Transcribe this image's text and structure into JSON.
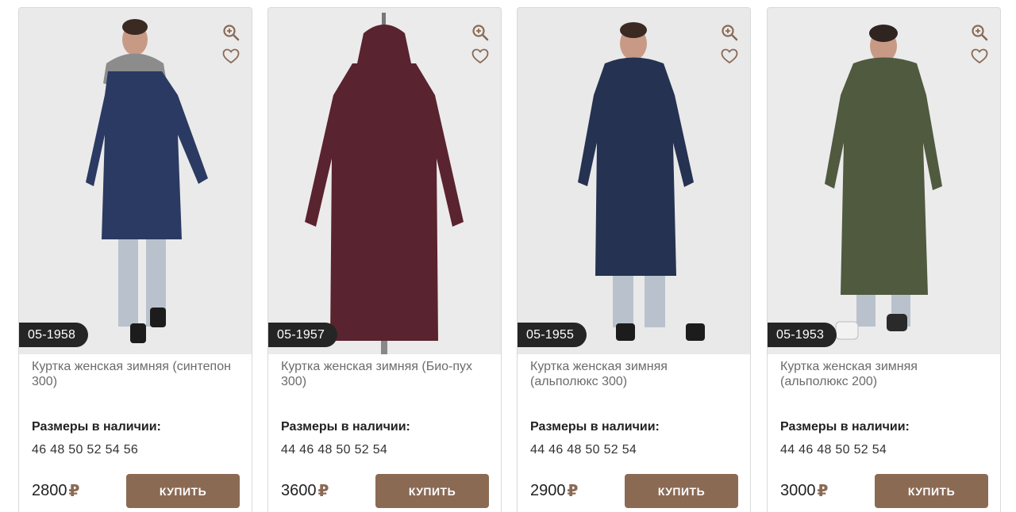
{
  "colors": {
    "accent": "#8b6a54",
    "badge": "#252525",
    "currency": "#8a6a55"
  },
  "icons": {
    "zoom": "zoom-in-icon",
    "favorite": "heart-icon"
  },
  "products": [
    {
      "article": "05-1958",
      "title": "Куртка женская зимняя (синтепон 300)",
      "sizes_label": "Размеры в наличии:",
      "sizes": "46 48 50 52 54 56",
      "price": "2800",
      "currency": "₽",
      "buy_label": "КУПИТЬ",
      "coat_color": "#2b3a63"
    },
    {
      "article": "05-1957",
      "title": "Куртка женская зимняя (Био-пух 300)",
      "sizes_label": "Размеры в наличии:",
      "sizes": "44 46 48 50 52 54",
      "price": "3600",
      "currency": "₽",
      "buy_label": "КУПИТЬ",
      "coat_color": "#5a2330"
    },
    {
      "article": "05-1955",
      "title": "Куртка женская зимняя (альполюкс 300)",
      "sizes_label": "Размеры в наличии:",
      "sizes": "44 46 48 50 52 54",
      "price": "2900",
      "currency": "₽",
      "buy_label": "КУПИТЬ",
      "coat_color": "#253252"
    },
    {
      "article": "05-1953",
      "title": "Куртка женская зимняя (альполюкс 200)",
      "sizes_label": "Размеры в наличии:",
      "sizes": "44 46 48 50 52 54",
      "price": "3000",
      "currency": "₽",
      "buy_label": "КУПИТЬ",
      "coat_color": "#4f5a3f"
    }
  ]
}
